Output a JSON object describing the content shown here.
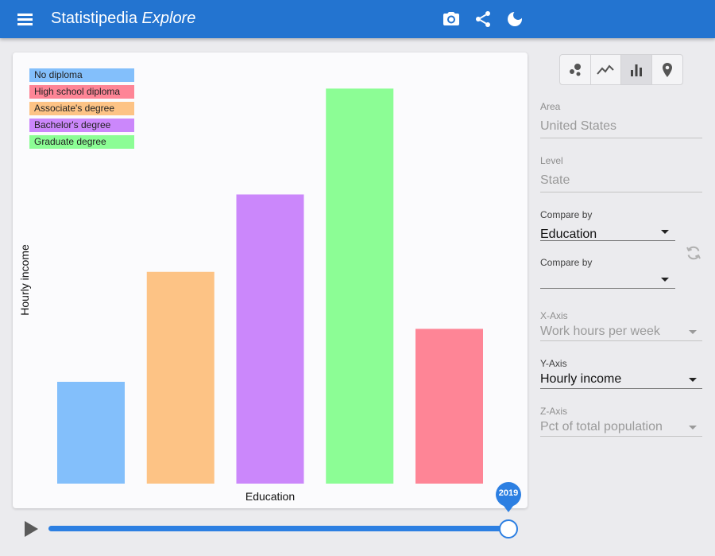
{
  "app": {
    "title_main": "Statistipedia",
    "title_sub": "Explore",
    "menu_icon": "menu-icon",
    "actions": [
      {
        "icon": "camera-icon"
      },
      {
        "icon": "share-icon"
      },
      {
        "icon": "dark-mode-icon"
      }
    ]
  },
  "chart_data": {
    "type": "bar",
    "categories": [
      "No diploma",
      "Associate's degree",
      "Bachelor's degree",
      "Graduate degree",
      "High school diploma"
    ],
    "values": [
      12.5,
      26.0,
      35.5,
      48.5,
      19.0
    ],
    "colors": [
      "#83bffb",
      "#fdc385",
      "#cb87fb",
      "#8cfd95",
      "#fe8596"
    ],
    "ylim": [
      0,
      50
    ],
    "xlabel": "Education",
    "ylabel": "Hourly income",
    "legend": [
      {
        "label": "No diploma",
        "color": "#83bffb"
      },
      {
        "label": "High school diploma",
        "color": "#fe8596"
      },
      {
        "label": "Associate's degree",
        "color": "#fdc385"
      },
      {
        "label": "Bachelor's degree",
        "color": "#cb87fb"
      },
      {
        "label": "Graduate degree",
        "color": "#8cfd95"
      }
    ],
    "legend_position": "top-left",
    "grid": false
  },
  "timeline": {
    "year": "2019",
    "progress": 1.0,
    "play_icon": "play-icon",
    "accent": "#2c7fe2"
  },
  "chart_types": [
    {
      "icon": "scatter-chart-icon",
      "active": false
    },
    {
      "icon": "line-chart-icon",
      "active": false
    },
    {
      "icon": "bar-chart-icon",
      "active": true
    },
    {
      "icon": "map-pin-icon",
      "active": false
    }
  ],
  "controls": {
    "area": {
      "label": "Area",
      "value": "United States"
    },
    "level": {
      "label": "Level",
      "value": "State"
    },
    "compare_by_1": {
      "label": "Compare by",
      "value": "Education"
    },
    "compare_by_2": {
      "label": "Compare by",
      "value": ""
    },
    "x_axis": {
      "label": "X-Axis",
      "value": "Work hours per week"
    },
    "y_axis": {
      "label": "Y-Axis",
      "value": "Hourly income"
    },
    "z_axis": {
      "label": "Z-Axis",
      "value": "Pct of total population"
    },
    "swap_icon": "swap-icon"
  },
  "colors": {
    "appbar": "#2374d0",
    "background": "#ebebee"
  }
}
